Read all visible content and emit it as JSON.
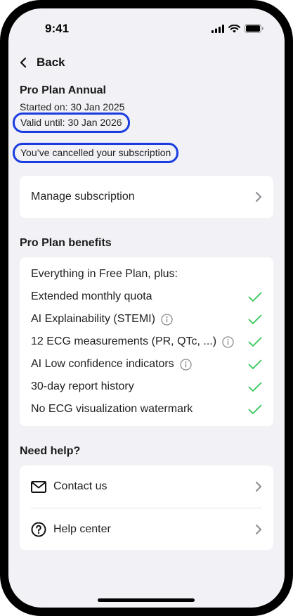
{
  "status_bar": {
    "time": "9:41"
  },
  "nav": {
    "back_label": "Back"
  },
  "plan": {
    "name": "Pro Plan Annual",
    "started": "Started on: 30 Jan 2025",
    "valid_until": "Valid until: 30 Jan 2026",
    "cancel_note": "You’ve cancelled your subscription"
  },
  "manage": {
    "label": "Manage subscription"
  },
  "benefits": {
    "title": "Pro Plan benefits",
    "intro": "Everything in Free Plan, plus:",
    "items": [
      {
        "label": "Extended monthly quota",
        "info": false
      },
      {
        "label": "AI Explainability (STEMI)",
        "info": true
      },
      {
        "label": "12 ECG measurements (PR, QTc, ...)",
        "info": true
      },
      {
        "label": "AI Low confidence indicators",
        "info": true
      },
      {
        "label": "30-day report history",
        "info": false
      },
      {
        "label": "No ECG visualization watermark",
        "info": false
      }
    ]
  },
  "help": {
    "title": "Need help?",
    "contact_label": "Contact us",
    "help_center_label": "Help center"
  },
  "colors": {
    "check": "#34c759",
    "highlight": "#1b3de0",
    "background": "#f2f2f6"
  }
}
